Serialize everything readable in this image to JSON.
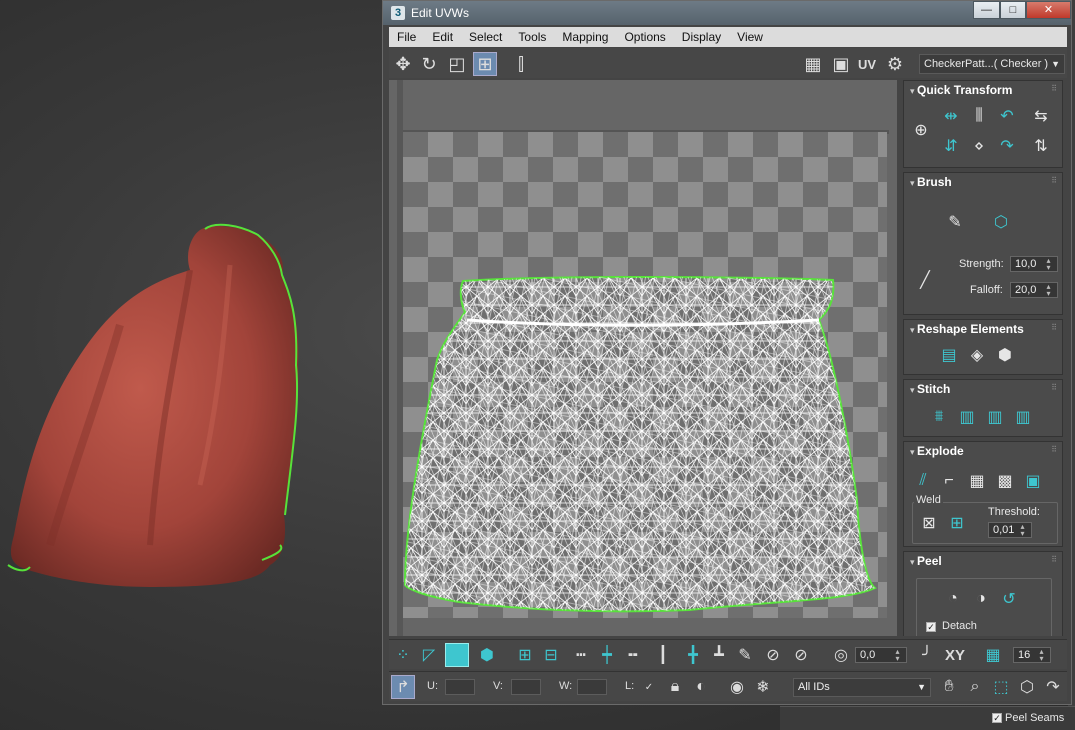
{
  "window": {
    "title": "Edit UVWs",
    "app_icon": "3",
    "min": "—",
    "max": "□",
    "close": "✕"
  },
  "menu": [
    "File",
    "Edit",
    "Select",
    "Tools",
    "Mapping",
    "Options",
    "Display",
    "View"
  ],
  "toolbar": {
    "uv_label": "UV",
    "checker_value": "CheckerPatt...( Checker )"
  },
  "rollouts": {
    "quick_transform": "Quick Transform",
    "brush": "Brush",
    "strength_label": "Strength:",
    "strength_value": "10,0",
    "falloff_label": "Falloff:",
    "falloff_value": "20,0",
    "reshape": "Reshape Elements",
    "stitch": "Stitch",
    "explode": "Explode",
    "weld": "Weld",
    "threshold_label": "Threshold:",
    "threshold_value": "0,01",
    "peel": "Peel",
    "detach_label": "Detach",
    "detach_checked": true
  },
  "bottom": {
    "angle_value": "0,0",
    "xy_label": "XY",
    "grid_value": "16",
    "u_label": "U:",
    "v_label": "V:",
    "w_label": "W:",
    "l_label": "L:",
    "ids_value": "All IDs"
  },
  "background": {
    "peel_seams_label": "Peel Seams",
    "peel_seams_checked": true
  },
  "colors": {
    "accent": "#3ec6cf",
    "selection_green": "#57e23a",
    "bag_red": "#a8463b"
  }
}
